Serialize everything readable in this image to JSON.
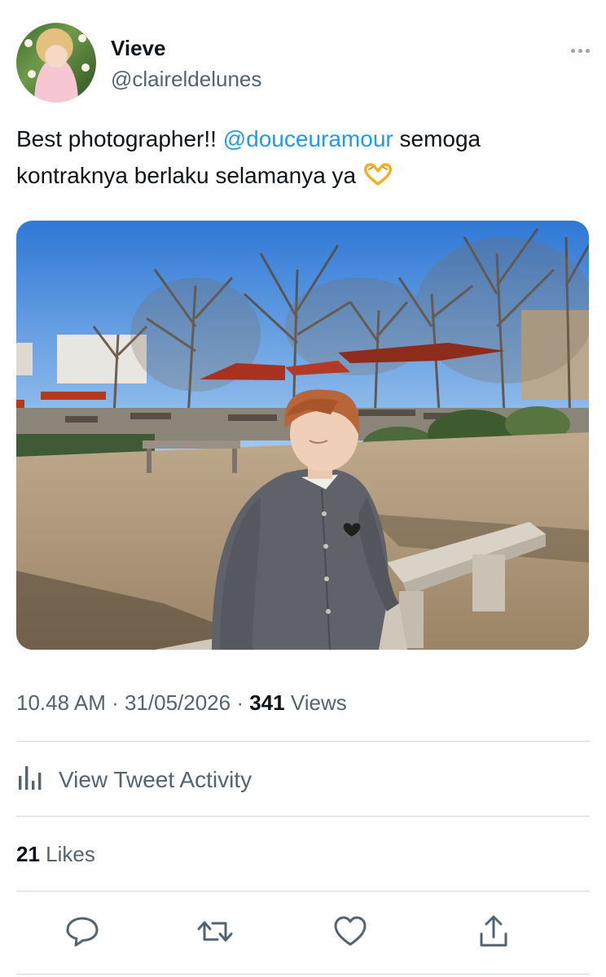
{
  "author": {
    "display_name": "Vieve",
    "handle": "@claireldelunes"
  },
  "tweet": {
    "text_before": "Best photographer!! ",
    "mention": "@douceuramour",
    "text_after": " semoga kontraknya berlaku selamanya ya",
    "emoji": "heart-hands-emoji"
  },
  "meta": {
    "time": "10.48 AM",
    "sep1": " · ",
    "date": "31/05/2026",
    "sep2": " · ",
    "views_count": "341",
    "views_label": " Views"
  },
  "activity": {
    "label": "View Tweet Activity"
  },
  "likes": {
    "count": "21",
    "label": " Likes"
  },
  "actions": [
    "reply-icon",
    "retweet-icon",
    "like-icon",
    "share-icon"
  ],
  "colors": {
    "mention": "#1d9bf0",
    "secondary_text": "#536471",
    "primary_text": "#0f1419",
    "divider": "#cfd9de"
  }
}
